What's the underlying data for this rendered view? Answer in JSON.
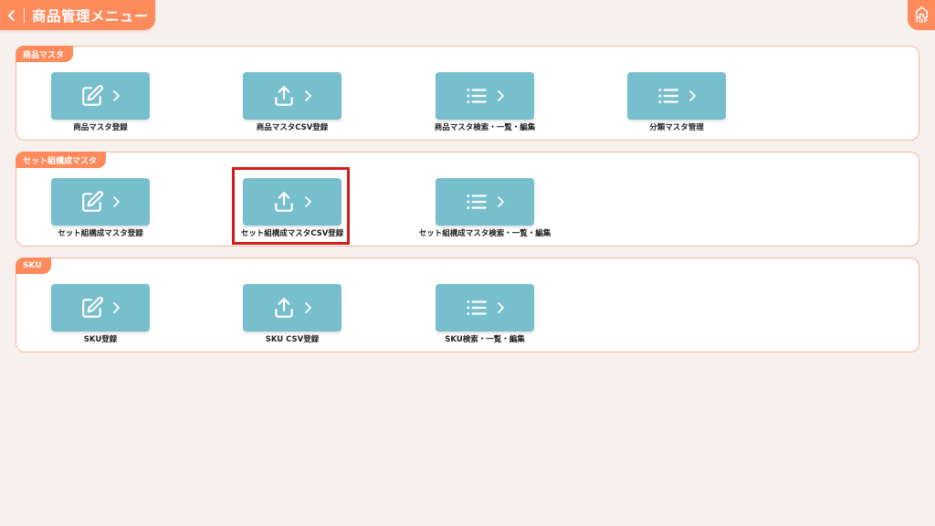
{
  "header": {
    "title": "商品管理メニュー"
  },
  "top_button": {
    "label": "TOP"
  },
  "sections": [
    {
      "title": "商品マスタ",
      "items": [
        {
          "label": "商品マスタ登録",
          "icon": "edit-icon"
        },
        {
          "label": "商品マスタCSV登録",
          "icon": "upload-icon"
        },
        {
          "label": "商品マスタ検索・一覧・編集",
          "icon": "list-icon"
        },
        {
          "label": "分類マスタ管理",
          "icon": "list-icon"
        }
      ]
    },
    {
      "title": "セット組構成マスタ",
      "items": [
        {
          "label": "セット組構成マスタ登録",
          "icon": "edit-icon"
        },
        {
          "label": "セット組構成マスタCSV登録",
          "icon": "upload-icon"
        },
        {
          "label": "セット組構成マスタ検索・一覧・編集",
          "icon": "list-icon"
        }
      ]
    },
    {
      "title": "SKU",
      "items": [
        {
          "label": "SKU登録",
          "icon": "edit-icon"
        },
        {
          "label": "SKU CSV登録",
          "icon": "upload-icon"
        },
        {
          "label": "SKU検索・一覧・編集",
          "icon": "list-icon"
        }
      ]
    }
  ],
  "colors": {
    "accent": "#ff8a5c",
    "tile": "#77bfcc",
    "highlight": "#d41a1a",
    "background": "#f7f1ee"
  }
}
